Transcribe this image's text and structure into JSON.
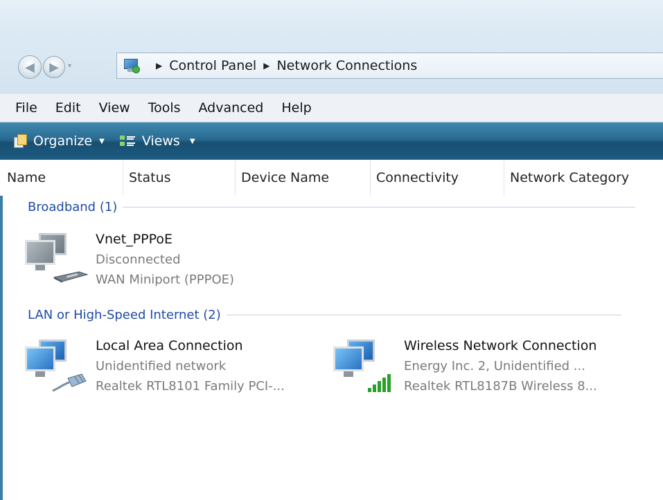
{
  "window": {
    "breadcrumb": [
      "Control Panel",
      "Network Connections"
    ],
    "back_glyph": "◀",
    "forward_glyph": "▶",
    "nav_dropdown_glyph": "▾",
    "breadcrumb_sep_glyph": "▶"
  },
  "menubar": {
    "items": [
      "File",
      "Edit",
      "View",
      "Tools",
      "Advanced",
      "Help"
    ]
  },
  "commandbar": {
    "organize_label": "Organize",
    "views_label": "Views",
    "dropdown_glyph": "▼"
  },
  "columns": [
    "Name",
    "Status",
    "Device Name",
    "Connectivity",
    "Network Category"
  ],
  "groups": [
    {
      "label": "Broadband (1)",
      "items": [
        {
          "name": "Vnet_PPPoE",
          "status": "Disconnected",
          "device": "WAN Miniport (PPPOE)",
          "icon": "modem-disconnected-icon"
        }
      ]
    },
    {
      "label": "LAN or High-Speed Internet (2)",
      "items": [
        {
          "name": "Local Area Connection",
          "status": "Unidentified network",
          "device": "Realtek RTL8101 Family PCI-...",
          "icon": "ethernet-cable-icon"
        },
        {
          "name": "Wireless Network Connection",
          "status": "Energy Inc.  2, Unidentified ...",
          "device": "Realtek RTL8187B Wireless 8...",
          "icon": "wireless-signal-icon"
        }
      ]
    }
  ],
  "colors": {
    "group_header": "#1f4aa8",
    "secondary_text": "#7a7a7a",
    "command_bar": "#1c5a80",
    "signal_green": "#2aa02a"
  }
}
